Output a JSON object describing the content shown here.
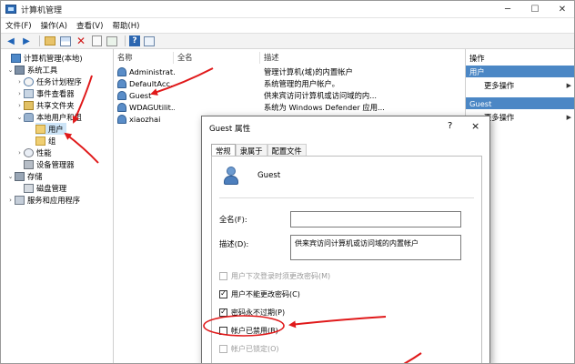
{
  "window": {
    "title": "计算机管理"
  },
  "menu": [
    "文件(F)",
    "操作(A)",
    "查看(V)",
    "帮助(H)"
  ],
  "toolbar_icons": [
    "back-arrow-icon",
    "forward-arrow-icon",
    "up-folder-icon",
    "show-tree-icon",
    "delete-icon",
    "properties-icon",
    "export-list-icon",
    "help-icon",
    "view-icon"
  ],
  "tree": {
    "root": "计算机管理(本地)",
    "system_tools": "系统工具",
    "task_scheduler": "任务计划程序",
    "event_viewer": "事件查看器",
    "shared_folders": "共享文件夹",
    "local_users_groups": "本地用户和组",
    "users": "用户",
    "groups": "组",
    "performance": "性能",
    "device_manager": "设备管理器",
    "storage": "存储",
    "disk_management": "磁盘管理",
    "services_apps": "服务和应用程序"
  },
  "list": {
    "headers": [
      "名称",
      "全名",
      "描述"
    ],
    "rows": [
      {
        "name": "Administrat...",
        "full": "",
        "desc": "管理计算机(域)的内置帐户"
      },
      {
        "name": "DefaultAcc...",
        "full": "",
        "desc": "系统管理的用户帐户。"
      },
      {
        "name": "Guest",
        "full": "",
        "desc": "供来宾访问计算机或访问域的内..."
      },
      {
        "name": "WDAGUtilit...",
        "full": "",
        "desc": "系统为 Windows Defender 应用..."
      },
      {
        "name": "xiaozhai",
        "full": "",
        "desc": ""
      }
    ]
  },
  "actions": {
    "title": "操作",
    "section1": "用户",
    "more1": "更多操作",
    "section2": "Guest",
    "more2": "更多操作"
  },
  "dialog": {
    "title": "Guest 属性",
    "help": "?",
    "close": "×",
    "tabs": [
      "常规",
      "隶属于",
      "配置文件"
    ],
    "username": "Guest",
    "fullname_label": "全名(F):",
    "fullname_value": "",
    "desc_label": "描述(D):",
    "desc_value": "供来宾访问计算机或访问域的内置帐户",
    "checkboxes": [
      {
        "label": "用户下次登录时须更改密码(M)",
        "checked": false,
        "disabled": true
      },
      {
        "label": "用户不能更改密码(C)",
        "checked": true,
        "disabled": false
      },
      {
        "label": "密码永不过期(P)",
        "checked": true,
        "disabled": false
      },
      {
        "label": "帐户已禁用(B)",
        "checked": false,
        "disabled": false
      },
      {
        "label": "帐户已锁定(O)",
        "checked": false,
        "disabled": true
      }
    ]
  },
  "colors": {
    "accent": "#4b87c5",
    "selection": "#cce4f7",
    "annotation": "#e0191a"
  }
}
